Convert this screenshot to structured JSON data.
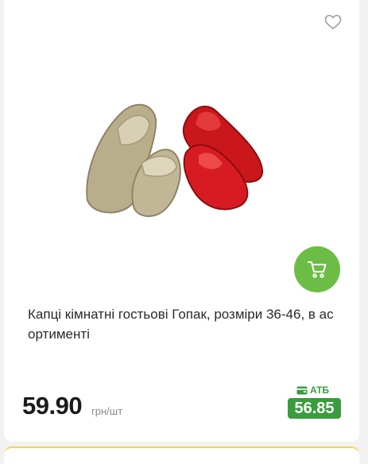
{
  "product": {
    "title": "Капці кімнатні гостьові Гопак, розміри 36-46, в асортименті",
    "price": "59.90",
    "unit": "грн/шт",
    "store_label": "АТБ",
    "store_price": "56.85"
  },
  "icons": {
    "favorite": "heart-outline-icon",
    "cart": "shopping-cart-icon",
    "store": "wallet-icon"
  },
  "colors": {
    "cart_button": "#6cbd45",
    "store_price_bg": "#3a9c3d"
  }
}
